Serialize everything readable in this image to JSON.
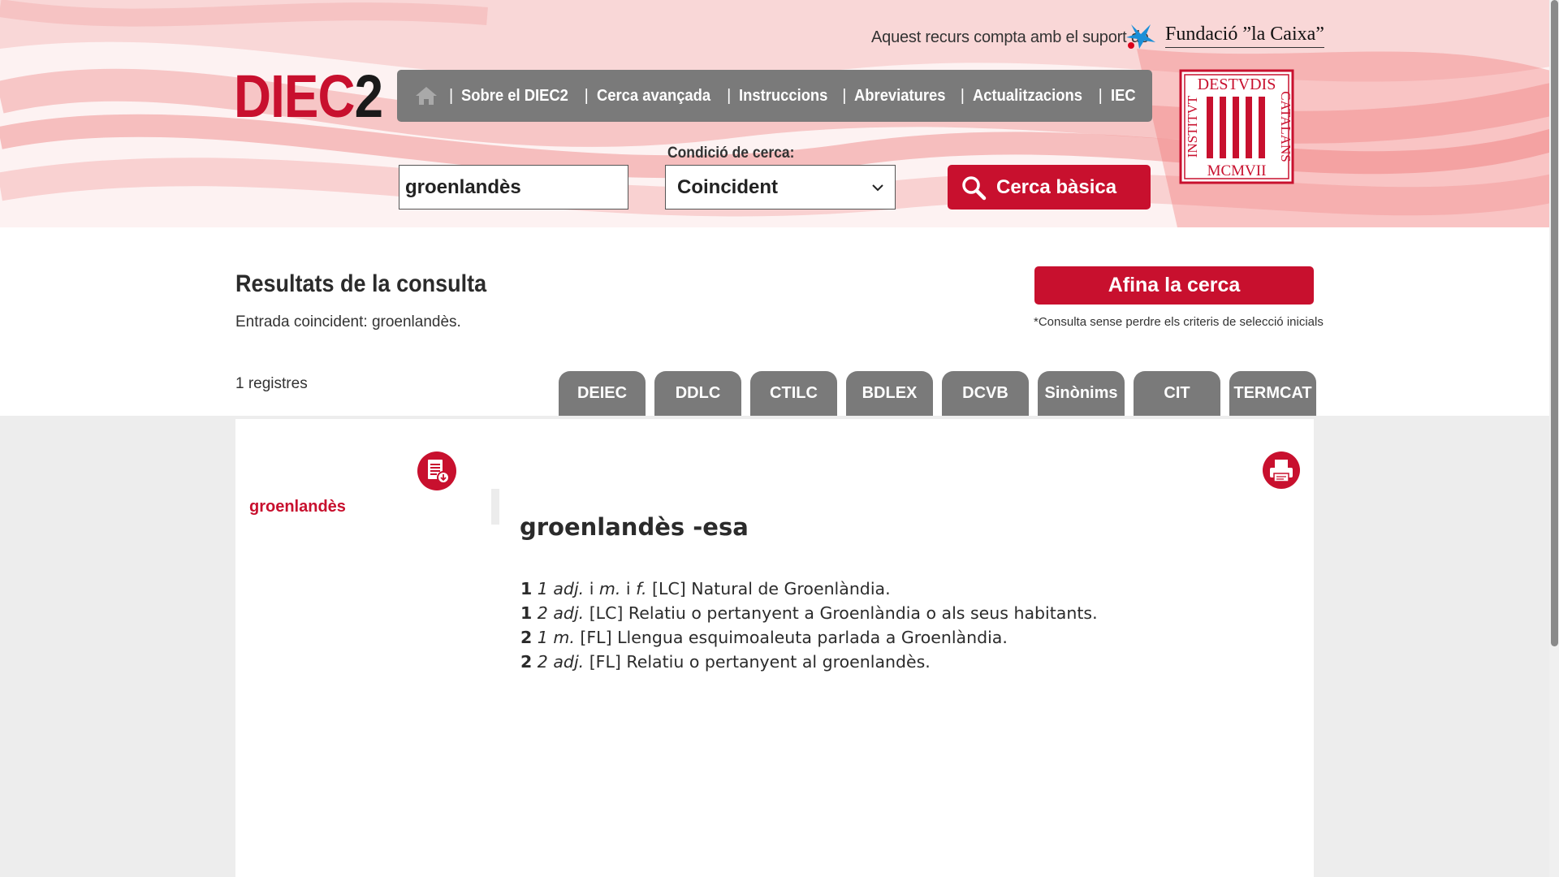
{
  "header": {
    "sponsor_text": "Aquest recurs compta amb el suport de",
    "sponsor_name": "Fundació ”la Caixa”",
    "logo_main": "DIEC",
    "logo_num": "2"
  },
  "nav": {
    "items": [
      "Sobre el DIEC2",
      "Cerca avançada",
      "Instruccions",
      "Abreviatures",
      "Actualitzacions",
      "IEC"
    ]
  },
  "search": {
    "value": "groenlandès",
    "condition_label": "Condició de cerca:",
    "condition_value": "Coincident",
    "button_label": "Cerca bàsica"
  },
  "results": {
    "title": "Resultats de la consulta",
    "entry_text": "Entrada coincident: groenlandès.",
    "refine_label": "Afina la cerca",
    "refine_note": "*Consulta sense perdre els criteris de selecció inicials",
    "count": "1 registres"
  },
  "dict_tabs": [
    "DEIEC",
    "DDLC",
    "CTILC",
    "BDLEX",
    "DCVB",
    "Sinònims",
    "CIT",
    "TERMCAT"
  ],
  "entry": {
    "list_word": "groenlandès",
    "headword": "groenlandès -esa",
    "senses": [
      {
        "n1": "1",
        "n2": "1",
        "gram": "adj.",
        "mid": " i ",
        "gram2": "m.",
        "mid2": " i ",
        "gram3": "f.",
        "text": " [LC] Natural de Groenlàndia."
      },
      {
        "n1": "1",
        "n2": "2",
        "gram": "adj.",
        "mid": "",
        "gram2": "",
        "mid2": "",
        "gram3": "",
        "text": " [LC] Relatiu o pertanyent a Groenlàndia o als seus habitants."
      },
      {
        "n1": "2",
        "n2": "1",
        "gram": "m.",
        "mid": "",
        "gram2": "",
        "mid2": "",
        "gram3": "",
        "text": " [FL] Llengua esquimoaleuta parlada a Groenlàndia."
      },
      {
        "n1": "2",
        "n2": "2",
        "gram": "adj.",
        "mid": "",
        "gram2": "",
        "mid2": "",
        "gram3": "",
        "text": " [FL] Relatiu o pertanyent al groenlandès."
      }
    ]
  },
  "seal": {
    "top": "DESTVDIS",
    "left": "INSTITVT",
    "right": "CATALANS",
    "bottom": "MCMVII"
  },
  "colors": {
    "accent": "#c8102e",
    "nav_gray": "#7a7a7a",
    "sponsor_blue": "#1b8fd8"
  },
  "icons": [
    "home-icon",
    "search-icon",
    "pdf-icon",
    "print-icon",
    "chevron-down-icon",
    "star-icon"
  ]
}
